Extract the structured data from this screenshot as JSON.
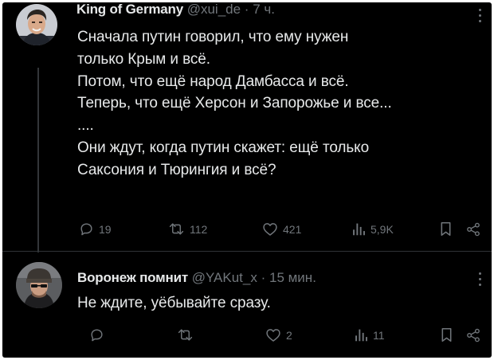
{
  "tweet1": {
    "author_name": "King of Germany",
    "handle": "@xui_de",
    "separator": "·",
    "time": "7 ч.",
    "lines": [
      "Сначала путин говорил, что ему нужен",
      "только Крым и всё.",
      "Потом, что ещё народ Дамбасса и всё.",
      "Теперь, что ещё Херсон и Запорожье и все...",
      "....",
      "Они ждут, когда путин скажет: ещё только",
      "Саксония и Тюрингия и всё?"
    ],
    "replies": "19",
    "reposts": "112",
    "likes": "421",
    "views": "5,9K"
  },
  "tweet2": {
    "author_name": "Воронеж помнит",
    "handle": "@YAKut_x",
    "separator": "·",
    "time": "15 мин.",
    "lines": [
      "Не ждите, уёбывайте сразу."
    ],
    "replies": "",
    "reposts": "",
    "likes": "2",
    "views": "11"
  },
  "icons": {
    "reply": "reply-icon",
    "repost": "repost-icon",
    "like": "like-icon",
    "views": "views-icon",
    "bookmark": "bookmark-icon",
    "share": "share-icon",
    "more": "more-icon"
  },
  "colors": {
    "background": "#000000",
    "text": "#e7e9ea",
    "secondary": "#71767b",
    "divider": "#2f3336"
  }
}
